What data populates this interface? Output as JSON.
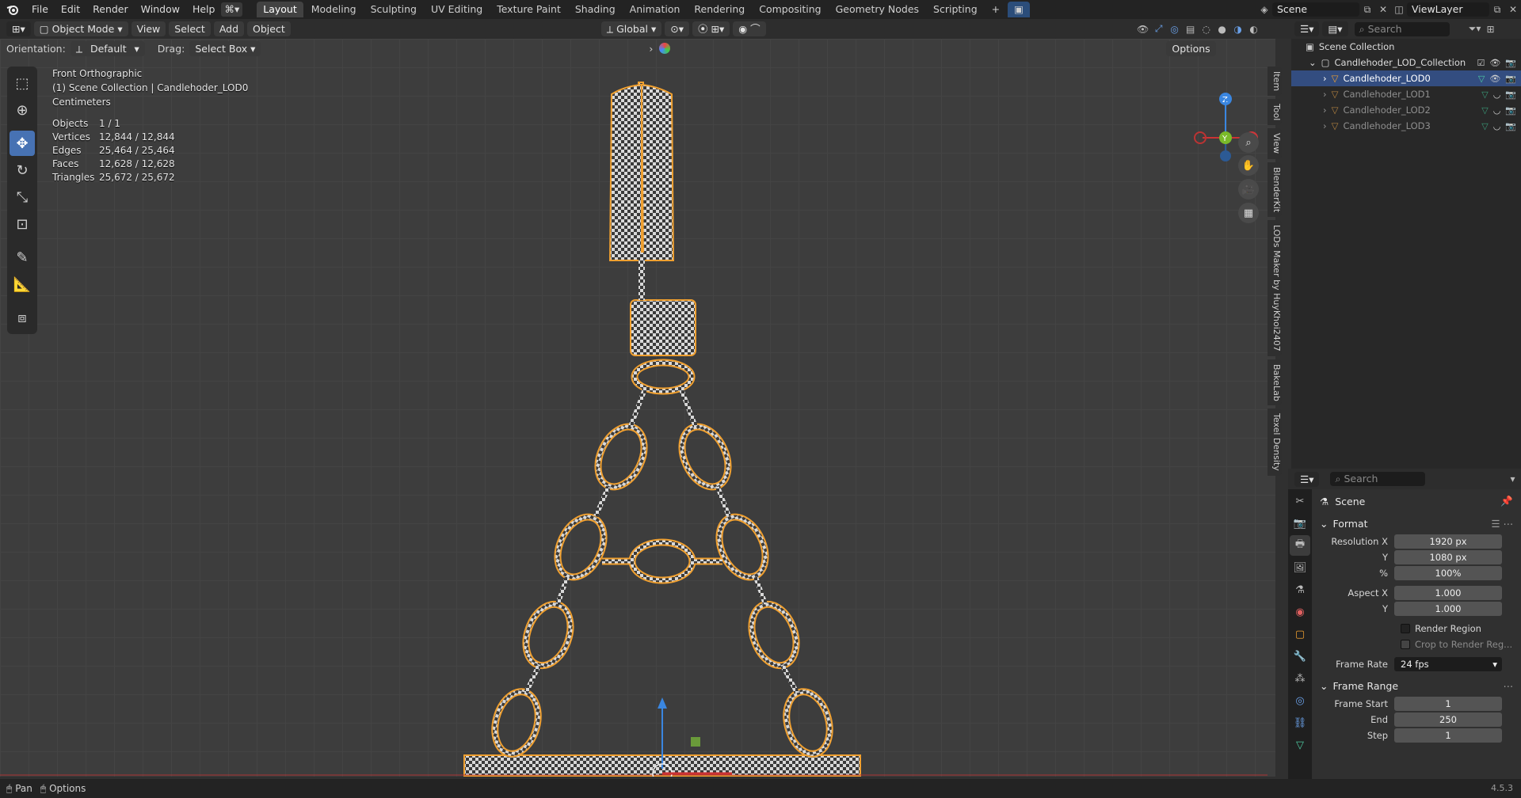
{
  "topbar": {
    "menus": [
      "File",
      "Edit",
      "Render",
      "Window",
      "Help"
    ],
    "workspaces": [
      "Layout",
      "Modeling",
      "Sculpting",
      "UV Editing",
      "Texture Paint",
      "Shading",
      "Animation",
      "Rendering",
      "Compositing",
      "Geometry Nodes",
      "Scripting"
    ],
    "active_workspace": "Layout",
    "scene": "Scene",
    "view_layer": "ViewLayer"
  },
  "viewport_header": {
    "mode": "Object Mode",
    "menus": [
      "View",
      "Select",
      "Add",
      "Object"
    ],
    "transform_orientation": "Global",
    "options_label": "Options"
  },
  "tool_header": {
    "orientation_label": "Orientation:",
    "orientation_value": "Default",
    "drag_label": "Drag:",
    "drag_value": "Select Box"
  },
  "viewport": {
    "view_name": "Front Orthographic",
    "collection_line": "(1) Scene Collection | Candlehoder_LOD0",
    "units": "Centimeters",
    "stats": [
      {
        "k": "Objects",
        "v": "1 / 1"
      },
      {
        "k": "Vertices",
        "v": "12,844 / 12,844"
      },
      {
        "k": "Edges",
        "v": "25,464 / 25,464"
      },
      {
        "k": "Faces",
        "v": "12,628 / 12,628"
      },
      {
        "k": "Triangles",
        "v": "25,672 / 25,672"
      }
    ],
    "side_tabs": [
      "Item",
      "Tool",
      "View",
      "BlenderKit",
      "LODs Maker by HuyKhoi2407",
      "BakeLab",
      "Texel Density"
    ],
    "gizmo": {
      "z": "Z",
      "y": "Y",
      "x": "X"
    }
  },
  "outliner": {
    "search_placeholder": "Search",
    "root": "Scene Collection",
    "collection": "Candlehoder_LOD_Collection",
    "objects": [
      {
        "name": "Candlehoder_LOD0",
        "selected": true
      },
      {
        "name": "Candlehoder_LOD1",
        "selected": false
      },
      {
        "name": "Candlehoder_LOD2",
        "selected": false
      },
      {
        "name": "Candlehoder_LOD3",
        "selected": false
      }
    ]
  },
  "properties": {
    "search_placeholder": "Search",
    "context": "Scene",
    "format": {
      "title": "Format",
      "res_x_label": "Resolution X",
      "res_x": "1920 px",
      "res_y_label": "Y",
      "res_y": "1080 px",
      "pct_label": "%",
      "pct": "100%",
      "aspect_x_label": "Aspect X",
      "aspect_x": "1.000",
      "aspect_y_label": "Y",
      "aspect_y": "1.000",
      "render_region": "Render Region",
      "crop": "Crop to Render Reg...",
      "frame_rate_label": "Frame Rate",
      "frame_rate": "24 fps"
    },
    "frame_range": {
      "title": "Frame Range",
      "start_label": "Frame Start",
      "start": "1",
      "end_label": "End",
      "end": "250",
      "step_label": "Step",
      "step": "1"
    }
  },
  "statusbar": {
    "pan": "Pan",
    "options": "Options",
    "version": "4.5.3"
  },
  "colors": {
    "accent": "#4772b3",
    "selection": "#f0a030",
    "background": "#3d3d3d"
  }
}
